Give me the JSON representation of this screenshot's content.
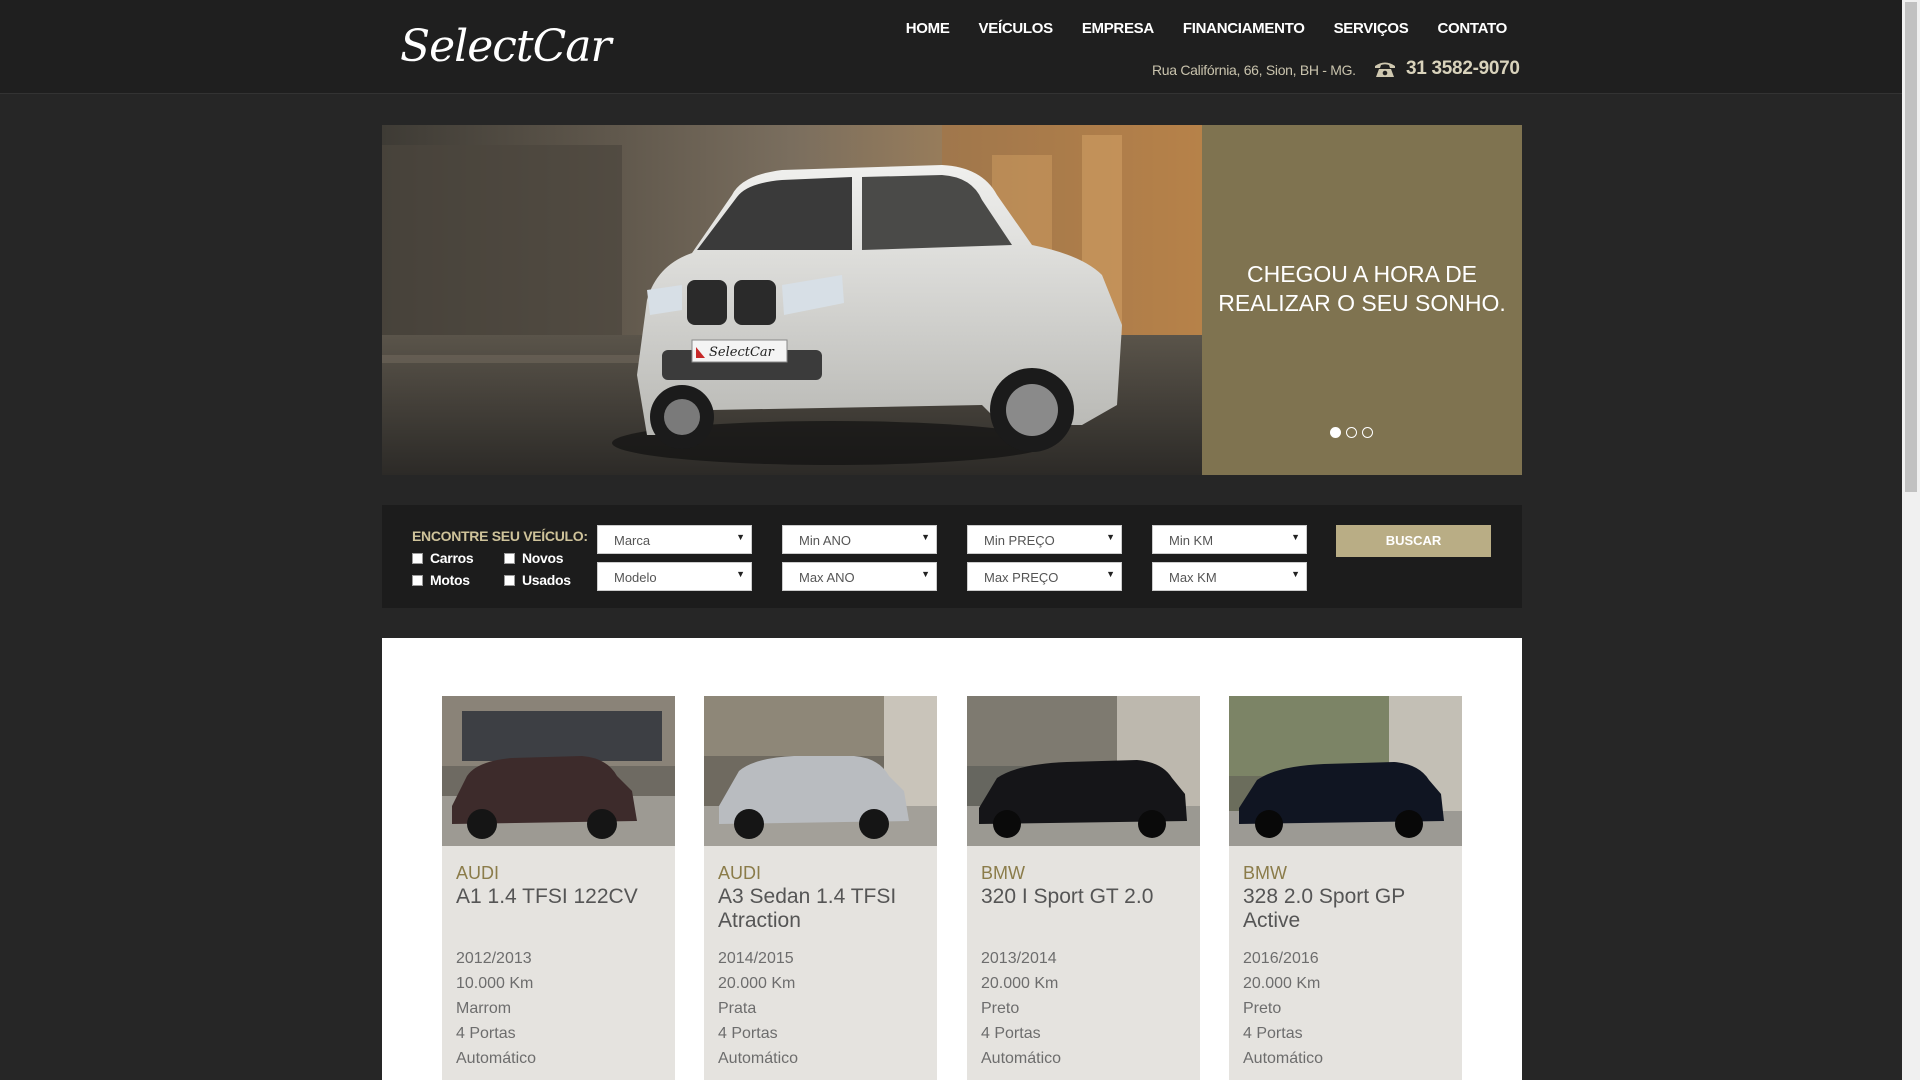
{
  "brand": {
    "logo_text": "SelectCar",
    "accent": "#c62828"
  },
  "nav": {
    "items": [
      "HOME",
      "VEÍCULOS",
      "EMPRESA",
      "FINANCIAMENTO",
      "SERVIÇOS",
      "CONTATO"
    ]
  },
  "contact": {
    "address": "Rua Califórnia, 66, Sion, BH - MG.",
    "phone": "31 3582-9070",
    "phone_icon": "phone-icon"
  },
  "hero": {
    "headline": "CHEGOU A HORA DE\nREALIZAR O SEU SONHO.",
    "plate_text": "SelectCar",
    "slides": 3,
    "active_slide": 1,
    "panel_color": "#7f7350"
  },
  "search": {
    "title": "ENCONTRE SEU VEÍCULO:",
    "checkboxes": [
      "Carros",
      "Novos",
      "Motos",
      "Usados"
    ],
    "selects": {
      "marca": "Marca",
      "modelo": "Modelo",
      "min_ano": "Min ANO",
      "max_ano": "Max ANO",
      "min_preco": "Min PREÇO",
      "max_preco": "Max PREÇO",
      "min_km": "Min KM",
      "max_km": "Max KM"
    },
    "button": "BUSCAR"
  },
  "vehicles": [
    {
      "brand": "AUDI",
      "model": "A1 1.4 TFSI 122CV",
      "year": "2012/2013",
      "km": "10.000 Km",
      "color": "Marrom",
      "doors": "4 Portas",
      "transmission": "Automático",
      "paint": "#3d2b2b"
    },
    {
      "brand": "AUDI",
      "model": "A3 Sedan 1.4 TFSI Atraction",
      "year": "2014/2015",
      "km": "20.000 Km",
      "color": "Prata",
      "doors": "4 Portas",
      "transmission": "Automático",
      "paint": "#b9bcc0"
    },
    {
      "brand": "BMW",
      "model": "320 I Sport GT 2.0",
      "year": "2013/2014",
      "km": "20.000 Km",
      "color": "Preto",
      "doors": "4 Portas",
      "transmission": "Automático",
      "paint": "#151518"
    },
    {
      "brand": "BMW",
      "model": "328 2.0 Sport GP Active",
      "year": "2016/2016",
      "km": "20.000 Km",
      "color": "Preto",
      "doors": "4 Portas",
      "transmission": "Automático",
      "paint": "#101522"
    }
  ]
}
